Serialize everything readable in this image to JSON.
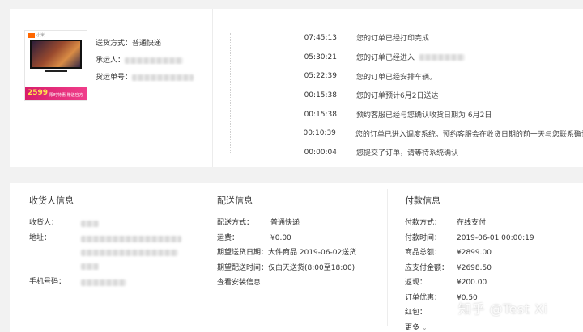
{
  "product": {
    "brand": "小米",
    "price": "2599",
    "promo": "限时特惠 赠送官方"
  },
  "shipping_summary": {
    "method_label": "送货方式：",
    "method_value": "普通快递",
    "carrier_label": "承运人：",
    "tracking_label": "货运单号："
  },
  "timeline": [
    {
      "time": "07:45:13",
      "text": "您的订单已经打印完成"
    },
    {
      "time": "05:30:21",
      "text": "您的订单已经进入"
    },
    {
      "time": "05:22:39",
      "text": "您的订单已经安排车辆。"
    },
    {
      "time": "00:15:38",
      "text": "您的订单预计6月2日送达"
    },
    {
      "time": "00:15:38",
      "text": "预约客服已经与您确认收货日期为 6月2日"
    },
    {
      "time": "00:10:39",
      "text": "您的订单已进入调度系统。预约客服会在收货日期的前一天与您联系确认"
    },
    {
      "time": "00:00:04",
      "text": "您提交了订单，请等待系统确认"
    }
  ],
  "receiver": {
    "title": "收货人信息",
    "name_label": "收货人：",
    "address_label": "地址：",
    "phone_label": "手机号码："
  },
  "delivery": {
    "title": "配送信息",
    "rows": [
      {
        "label": "配送方式：",
        "value": "普通快递"
      },
      {
        "label": "运费：",
        "value": "¥0.00"
      },
      {
        "label": "期望送货日期：",
        "value": "大件商品 2019-06-02送货"
      },
      {
        "label": "期望配送时间：",
        "value": "仅白天送货(8:00至18:00)"
      }
    ],
    "install_link": "查看安装信息"
  },
  "payment": {
    "title": "付款信息",
    "rows": [
      {
        "label": "付款方式：",
        "value": "在线支付"
      },
      {
        "label": "付款时间：",
        "value": "2019-06-01 00:00:19"
      },
      {
        "label": "商品总额：",
        "value": "¥2899.00"
      },
      {
        "label": "应支付金额：",
        "value": "¥2698.50"
      },
      {
        "label": "返现：",
        "value": "¥200.00"
      },
      {
        "label": "订单优惠：",
        "value": "¥0.50"
      },
      {
        "label": "红包：",
        "value": ""
      }
    ],
    "more_label": "更多"
  },
  "watermark": "知乎 @Test Xi"
}
